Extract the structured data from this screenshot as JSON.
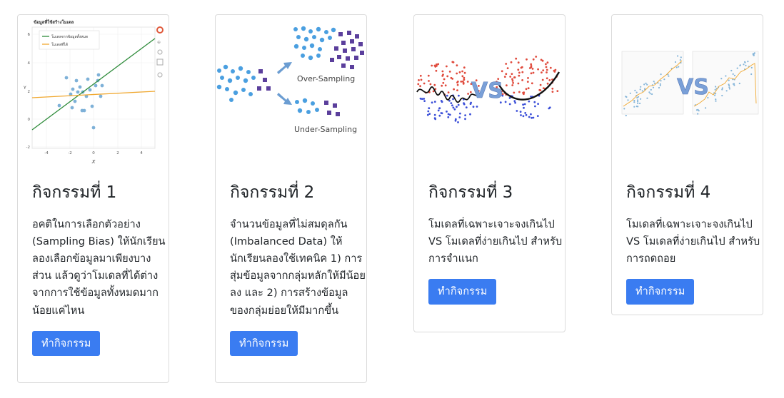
{
  "cards": [
    {
      "title": "กิจกรรมที่ 1",
      "text": "อคติในการเลือกตัวอย่าง (Sampling Bias) ให้นักเรียนลองเลือกข้อมูลมาเพียงบางส่วน แล้วดูว่าโมเดลที่ได้ต่างจากการใช้ข้อมูลทั้งหมดมากน้อยแค่ไหน",
      "button": "ทำกิจกรรม",
      "image": {
        "title": "ข้อมูลที่ใช้สร้างโมเดล",
        "legend": [
          "โมเดลจากข้อมูลทั้งหมด",
          "โมเดลที่ได้"
        ],
        "xlabel": "X",
        "ylabel": "Y",
        "xticks": [
          "-4",
          "-2",
          "0",
          "2",
          "4"
        ],
        "yticks": [
          "6",
          "4",
          "2",
          "0",
          "-2"
        ],
        "colors": {
          "all_data_line": "#2e8b3a",
          "sample_line": "#f0a830",
          "points": "#5e9ecf"
        }
      }
    },
    {
      "title": "กิจกรรมที่ 2",
      "text": "จำนวนข้อมูลที่ไม่สมดุลกัน (Imbalanced Data) ให้นักเรียนลองใช้เทคนิค 1) การสุ่มข้อมูลจากกลุ่มหลักให้มีน้อยลง และ 2) การสร้างข้อมูลของกลุ่มย่อยให้มีมากขึ้น",
      "button": "ทำกิจกรรม",
      "image": {
        "over_label": "Over-Sampling",
        "under_label": "Under-Sampling",
        "colors": {
          "majority": "#4a9fe0",
          "minority": "#5b3f9c",
          "arrow": "#6b9dd2"
        }
      }
    },
    {
      "title": "กิจกรรมที่ 3",
      "text": "โมเดลที่เฉพาะเจาะจงเกินไป VS โมเดลที่ง่ายเกินไป สำหรับการจำแนก",
      "button": "ทำกิจกรรม",
      "image": {
        "vs_label": "VS",
        "colors": {
          "class_a": "#e04a3c",
          "class_b": "#3b4fd8",
          "boundary": "#111111",
          "vs": "#7aa0d8"
        }
      }
    },
    {
      "title": "กิจกรรมที่ 4",
      "text": "โมเดลที่เฉพาะเจาะจงเกินไป VS โมเดลที่ง่ายเกินไป สำหรับการถดถอย",
      "button": "ทำกิจกรรม",
      "image": {
        "vs_label": "VS",
        "colors": {
          "points": "#5e9ecf",
          "fit": "#f0a830",
          "vs": "#7aa0d8"
        }
      }
    }
  ]
}
